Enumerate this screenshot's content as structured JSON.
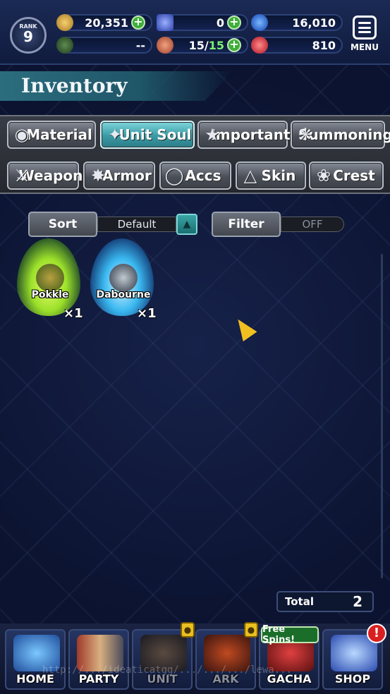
{
  "header": {
    "rank_label": "RANK",
    "rank_value": "9",
    "gil": "20,351",
    "lapis": "0",
    "blue_orbs": "16,010",
    "compass": "--",
    "stamina_current": "15",
    "stamina_max": "15",
    "red_orbs": "810",
    "menu_label": "MENU"
  },
  "page_title": "Inventory",
  "tabs_row1": [
    {
      "label": "Material",
      "icon": "bag-icon",
      "active": false
    },
    {
      "label": "Unit Soul",
      "icon": "soul-icon",
      "active": true
    },
    {
      "label": "Important",
      "icon": "star-icon",
      "active": false
    },
    {
      "label": "Summoning",
      "icon": "summon-icon",
      "active": false
    }
  ],
  "tabs_row2": [
    {
      "label": "Weapon",
      "icon": "sword-icon"
    },
    {
      "label": "Armor",
      "icon": "armor-icon"
    },
    {
      "label": "Accs",
      "icon": "ring-icon"
    },
    {
      "label": "Skin",
      "icon": "hanger-icon"
    },
    {
      "label": "Crest",
      "icon": "crest-icon"
    }
  ],
  "sort": {
    "label": "Sort",
    "value": "Default"
  },
  "filter": {
    "label": "Filter",
    "value": "OFF"
  },
  "items": [
    {
      "name": "Pokkle",
      "qty": "×1",
      "color": "#9be02a"
    },
    {
      "name": "Dabourne",
      "qty": "×1",
      "color": "#3ab8f0"
    }
  ],
  "total": {
    "label": "Total",
    "value": "2"
  },
  "nav": [
    {
      "label": "HOME",
      "locked": false
    },
    {
      "label": "PARTY",
      "locked": false
    },
    {
      "label": "UNIT",
      "locked": true
    },
    {
      "label": "ARK",
      "locked": true
    },
    {
      "label": "GACHA",
      "locked": false
    },
    {
      "label": "SHOP",
      "locked": false
    }
  ],
  "free_spins": "Free Spins!",
  "shop_badge": "!",
  "watermark": "http://.../ideaticatgg/.../.../.../lewa..."
}
